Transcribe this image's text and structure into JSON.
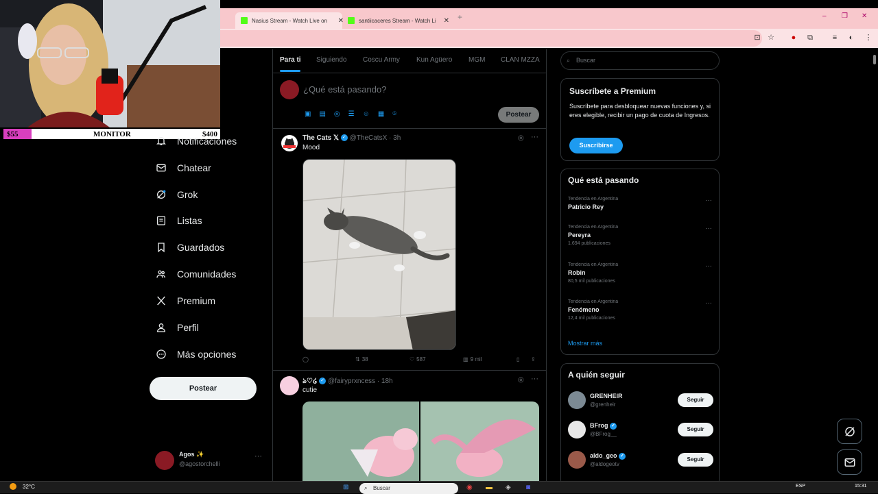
{
  "browser": {
    "tabs": [
      {
        "label": "Nasius Stream - Watch Live on",
        "active": true
      },
      {
        "label": "santiicaceres Stream - Watch Li",
        "active": false
      }
    ],
    "new_tab": "+",
    "window_controls": [
      "–",
      "❐",
      "✕"
    ]
  },
  "stream_overlay": {
    "monitor_label": "MONITOR",
    "left_amount": "$55",
    "right_amount": "$400",
    "progress": 0.13
  },
  "nav": {
    "items": [
      {
        "label": "Notificaciones",
        "icon": "bell-icon"
      },
      {
        "label": "Chatear",
        "icon": "mail-icon"
      },
      {
        "label": "Grok",
        "icon": "grok-icon"
      },
      {
        "label": "Listas",
        "icon": "list-icon"
      },
      {
        "label": "Guardados",
        "icon": "bookmark-icon"
      },
      {
        "label": "Comunidades",
        "icon": "communities-icon"
      },
      {
        "label": "Premium",
        "icon": "x-icon"
      },
      {
        "label": "Perfil",
        "icon": "person-icon"
      },
      {
        "label": "Más opciones",
        "icon": "more-circle-icon"
      }
    ],
    "post_button": "Postear",
    "account": {
      "name": "Agos ✨",
      "handle": "@agostorchelli"
    }
  },
  "feed": {
    "tabs": [
      "Para ti",
      "Siguiendo",
      "Coscu Army",
      "Kun Agüero",
      "MGM",
      "CLAN MZZA"
    ],
    "composer_placeholder": "¿Qué está pasando?",
    "composer_post_button": "Postear",
    "posts": [
      {
        "name": "The Cats 𝕏",
        "handle": "@TheCatsX",
        "time": "· 3h",
        "text": "Mood",
        "retweets": "38",
        "likes": "587",
        "views": "9 mil"
      },
      {
        "name": "ঌ♡໒",
        "handle": "@fairyprxncess",
        "time": "· 18h",
        "text": "cutie"
      }
    ]
  },
  "sidebar": {
    "search_placeholder": "Buscar",
    "premium": {
      "title": "Suscríbete a Premium",
      "body": "Suscríbete para desbloquear nuevas funciones y, si eres elegible, recibir un pago de cuota de Ingresos.",
      "button": "Suscribirse"
    },
    "trends": {
      "title": "Qué está pasando",
      "items": [
        {
          "context": "Tendencia en Argentina",
          "name": "Patricio Rey",
          "count": ""
        },
        {
          "context": "Tendencia en Argentina",
          "name": "Pereyra",
          "count": "1.694 publicaciones"
        },
        {
          "context": "Tendencia en Argentina",
          "name": "Robin",
          "count": "80,5 mil publicaciones"
        },
        {
          "context": "Tendencia en Argentina",
          "name": "Fenómeno",
          "count": "12,4 mil publicaciones"
        }
      ],
      "show_more": "Mostrar más"
    },
    "who_to_follow": {
      "title": "A quién seguir",
      "items": [
        {
          "name": "GRENHEIR",
          "handle": "@grenheir",
          "verified": false,
          "button": "Seguir"
        },
        {
          "name": "BFrog",
          "handle": "@BFrog__",
          "verified": true,
          "button": "Seguir"
        },
        {
          "name": "aldo_geo",
          "handle": "@aldogeotv",
          "verified": true,
          "button": "Seguir"
        }
      ]
    }
  },
  "taskbar": {
    "weather": "32°C",
    "search": "Buscar",
    "lang": "ESP",
    "time": "15:31"
  }
}
